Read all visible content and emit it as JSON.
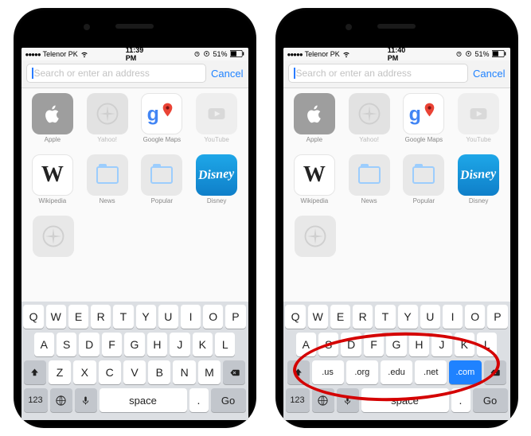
{
  "phones": [
    {
      "status": {
        "carrier": "Telenor PK",
        "time": "11:39 PM",
        "battery_pct": "51%"
      },
      "search_placeholder": "Search or enter an address",
      "cancel_label": "Cancel"
    },
    {
      "status": {
        "carrier": "Telenor PK",
        "time": "11:40 PM",
        "battery_pct": "51%"
      },
      "search_placeholder": "Search or enter an address",
      "cancel_label": "Cancel"
    }
  ],
  "bookmarks": {
    "row1": [
      {
        "name": "Apple",
        "style": "apple"
      },
      {
        "name": "Yahoo!",
        "style": "yahoo"
      },
      {
        "name": "Google Maps",
        "style": "gmaps"
      },
      {
        "name": "YouTube",
        "style": "youtube"
      }
    ],
    "row2": [
      {
        "name": "Wikipedia",
        "style": "wiki"
      },
      {
        "name": "News",
        "style": "folder"
      },
      {
        "name": "Popular",
        "style": "folder"
      },
      {
        "name": "Disney",
        "style": "disney"
      }
    ],
    "row3": [
      {
        "name": "",
        "style": "blank"
      }
    ]
  },
  "keyboard": {
    "rows": {
      "top": [
        "Q",
        "W",
        "E",
        "R",
        "T",
        "Y",
        "U",
        "I",
        "O",
        "P"
      ],
      "mid": [
        "A",
        "S",
        "D",
        "F",
        "G",
        "H",
        "J",
        "K",
        "L"
      ],
      "bot": [
        "Z",
        "X",
        "C",
        "V",
        "B",
        "N",
        "M"
      ]
    },
    "n123": "123",
    "space": "space",
    "go": "Go",
    "period": "."
  },
  "tld_row": [
    ".us",
    ".org",
    ".edu",
    ".net",
    ".com"
  ],
  "tld_active_index": 4,
  "colors": {
    "accent_blue": "#1f82ff",
    "annotation_red": "#d40000"
  }
}
